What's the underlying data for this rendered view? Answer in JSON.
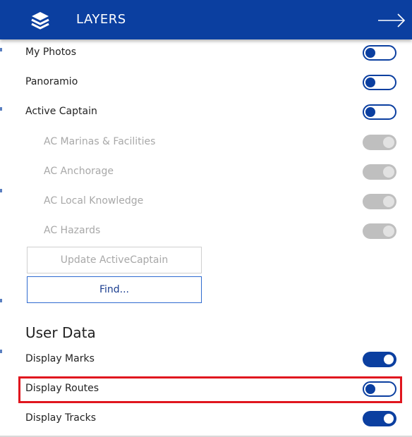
{
  "header": {
    "title": "LAYERS",
    "icon": "layers-icon",
    "close_icon": "arrow-right-icon",
    "color": "#0b3fa0"
  },
  "layers": [
    {
      "label": "My Photos",
      "state": "off"
    },
    {
      "label": "Panoramio",
      "state": "off"
    },
    {
      "label": "Active Captain",
      "state": "off"
    },
    {
      "label": "AC Marinas & Facilities",
      "state": "disabled"
    },
    {
      "label": "AC Anchorage",
      "state": "disabled"
    },
    {
      "label": "AC Local Knowledge",
      "state": "disabled"
    },
    {
      "label": "AC Hazards",
      "state": "disabled"
    }
  ],
  "buttons": {
    "update": "Update ActiveCaptain",
    "find": "Find..."
  },
  "user_data": {
    "title": "User Data",
    "items": [
      {
        "label": "Display Marks",
        "state": "on"
      },
      {
        "label": "Display Routes",
        "state": "off",
        "highlighted": true
      },
      {
        "label": "Display Tracks",
        "state": "on"
      }
    ]
  },
  "colors": {
    "accent": "#0b3fa0",
    "highlight": "#e0161e",
    "disabled": "#bfbfbf"
  }
}
